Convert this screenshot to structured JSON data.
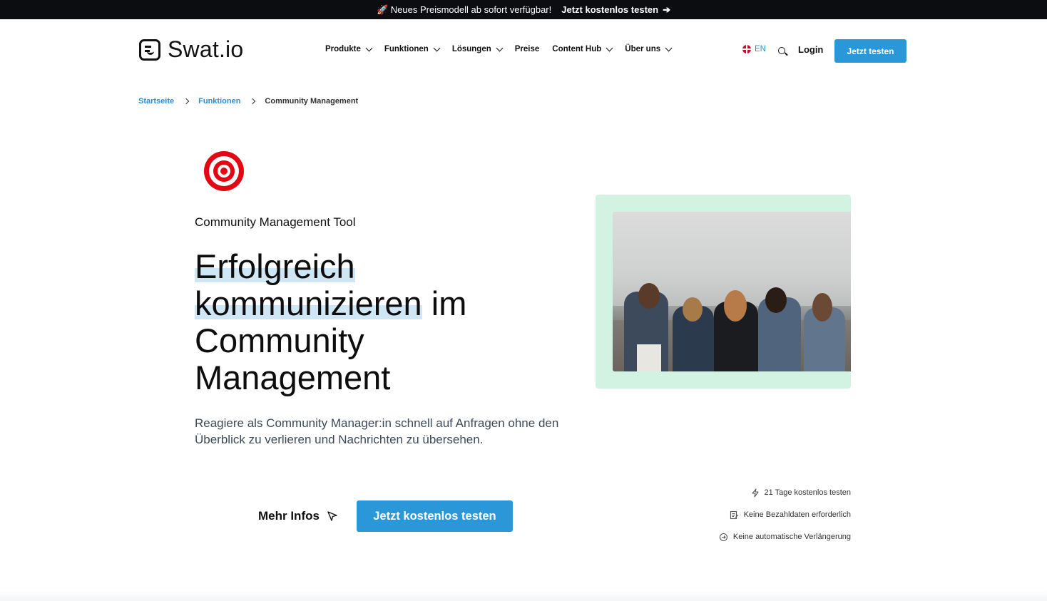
{
  "topbar": {
    "promo_icon": "rocket-icon",
    "promo_text": "🚀 Neues Preismodell ab sofort verfügbar!",
    "cta_label": "Jetzt kostenlos testen",
    "cta_icon": "arrow-right-icon"
  },
  "header": {
    "logo_text": "Swat.io",
    "nav": [
      {
        "label": "Produkte",
        "has_dropdown": true
      },
      {
        "label": "Funktionen",
        "has_dropdown": true
      },
      {
        "label": "Lösungen",
        "has_dropdown": true
      },
      {
        "label": "Preise",
        "has_dropdown": false
      },
      {
        "label": "Content Hub",
        "has_dropdown": true
      },
      {
        "label": "Über uns",
        "has_dropdown": true
      }
    ],
    "language": "EN",
    "login_label": "Login",
    "cta_label": "Jetzt testen"
  },
  "breadcrumb": {
    "items": [
      "Startseite",
      "Funktionen"
    ],
    "current": "Community Management"
  },
  "hero": {
    "icon": "target-icon",
    "eyebrow": "Community Management Tool",
    "headline_hl1": "Erfolgreich",
    "headline_hl2": "kommunizieren",
    "headline_rest1": " im",
    "headline_rest2": "Community",
    "headline_rest3": "Management",
    "lead": "Reagiere als Community Manager:in schnell auf Anfragen ohne den Überblick zu verlieren und Nachrichten zu übersehen.",
    "more_label": "Mehr Infos",
    "more_icon": "cursor-icon",
    "cta_label": "Jetzt kostenlos testen",
    "image": "group-of-women-at-beach-photo"
  },
  "benefits": [
    {
      "icon": "lightning-icon",
      "text": "21 Tage kostenlos testen"
    },
    {
      "icon": "document-edit-icon",
      "text": "Keine Bezahldaten erforderlich"
    },
    {
      "icon": "cancel-renew-icon",
      "text": "Keine automatische Verlängerung"
    }
  ],
  "colors": {
    "primary": "#2a98d8",
    "link": "#2a8fd6",
    "topbar_bg": "#0b0d11",
    "media_bg": "#d2f3e1",
    "highlight": "#cfe6f5",
    "target_red": "#e30613"
  }
}
